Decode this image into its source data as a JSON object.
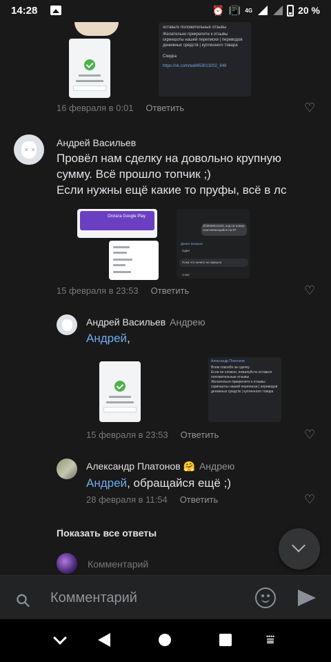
{
  "status_bar": {
    "time": "14:28",
    "battery_percent": "20 %",
    "network": "4G",
    "icons": [
      "gallery-icon",
      "alarm-icon",
      "vibrate-icon",
      "signal-icon",
      "signal-icon",
      "battery-icon"
    ]
  },
  "comments": [
    {
      "date": "16 февраля в 0:01",
      "reply_label": "Ответить",
      "attachment_texts": [
        "оставьте положительные отзывы",
        "Желательно прикрепите к отзывы скриншоты нашей переписки | переводов денежных средств | купленного товара",
        "Скидка",
        "https://vk.com/wall453013202_849"
      ]
    },
    {
      "author": "Андрей Васильев",
      "text_lines": [
        "Провёл нам сделку на довольно крупную",
        "сумму. Всё прошло топчик ;)",
        "Если нужны ещё какие то пруфы, всё в лс"
      ],
      "attachment_texts": [
        "Оплата Google Play",
        "@id539612323, код на номер оканчивающийся на 87",
        "Данил Захаров",
        "Сдал",
        "Пока что ничего не пришло",
        "А вот"
      ],
      "date": "15 февраля в 23:53",
      "reply_label": "Ответить"
    },
    {
      "author": "Андрей Васильев",
      "reply_to": "Андрею",
      "mention": "Андрей",
      "text_after_mention": ",",
      "attachment_texts": [
        "Александр Платонов",
        "Всем спасибо за сделку",
        "Если не сложно, пожалуйста оставьте положительные отзывы",
        "Желательно прикрепите к отзывы скриншоты нашей переписки | переводов денежных средств | купленного товара"
      ],
      "date": "15 февраля в 23:53",
      "reply_label": "Ответить"
    },
    {
      "author": "Александр Платонов 🤗",
      "reply_to": "Андрею",
      "mention": "Андрей",
      "text_after_mention": ", обращайся ещё ;)",
      "date": "28 февраля в 11:54",
      "reply_label": "Ответить"
    }
  ],
  "show_all_replies": "Показать все ответы",
  "comment_hint": "Комментарий",
  "composer": {
    "placeholder": "Комментарий"
  },
  "colors": {
    "background": "#19191a",
    "link": "#71aaeb",
    "secondary": "#76787a",
    "accent_green": "#4bb34b"
  }
}
